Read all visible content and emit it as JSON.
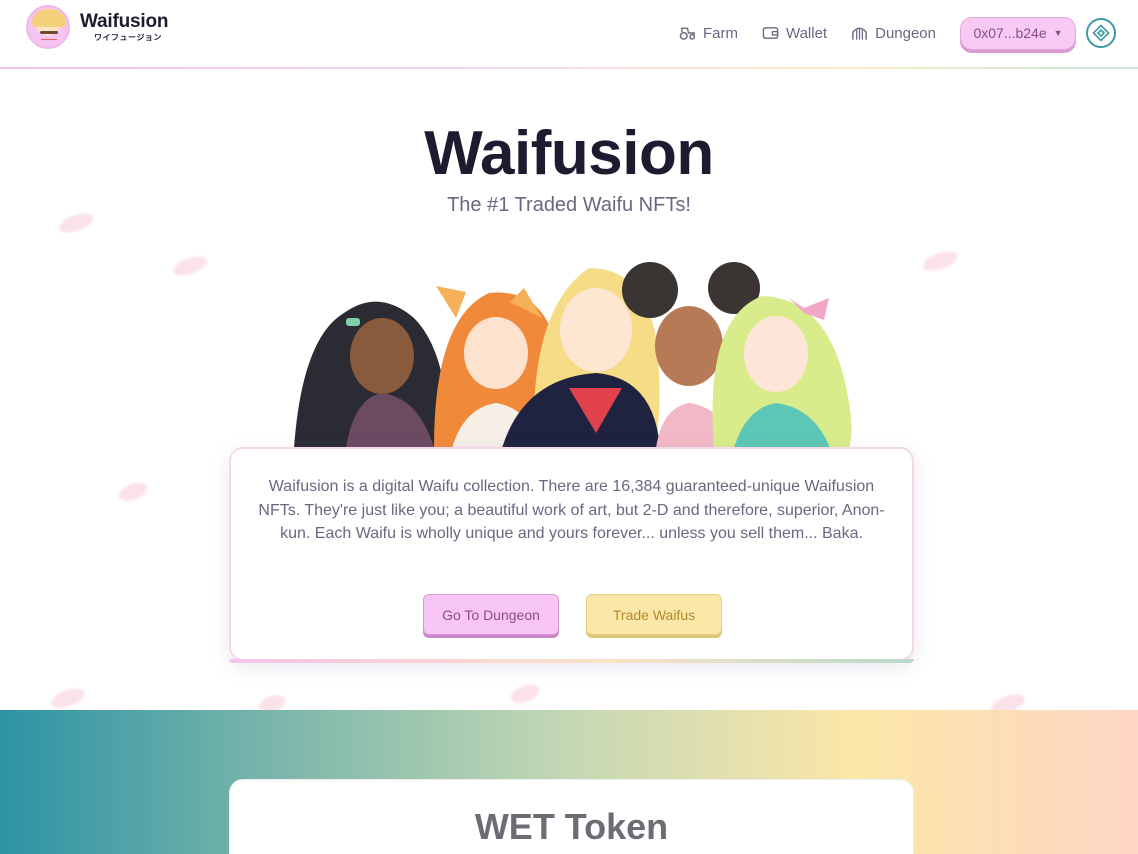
{
  "header": {
    "brand_name": "Waifusion",
    "brand_subtitle": "ワイフュージョン",
    "nav": [
      {
        "label": "Farm",
        "icon": "tractor-icon"
      },
      {
        "label": "Wallet",
        "icon": "wallet-icon"
      },
      {
        "label": "Dungeon",
        "icon": "dungeon-gate-icon"
      }
    ],
    "wallet_address": "0x07...b24e",
    "network_icon": "binance-icon"
  },
  "hero": {
    "title": "Waifusion",
    "subtitle": "The #1 Traded Waifu NFTs!",
    "description": "Waifusion is a digital Waifu collection. There are 16,384 guaranteed-unique Waifusion NFTs. They're just like you; a beautiful work of art, but 2-D and therefore, superior, Anon-kun. Each Waifu is wholly unique and yours forever... unless you sell them... Baka.",
    "primary_button": "Go To Dungeon",
    "secondary_button": "Trade Waifus"
  },
  "token_section": {
    "title": "WET Token"
  },
  "colors": {
    "pink_button": "#f8c6f5",
    "yellow_button": "#fbe8a8",
    "teal_accent": "#2d93a4",
    "heading": "#1e1b30"
  }
}
